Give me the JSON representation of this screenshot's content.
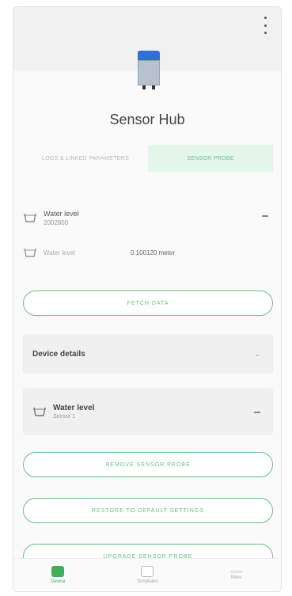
{
  "header": {
    "menu_icon": "kebab-menu-icon",
    "device_icon": "sensor-hub-device-icon",
    "title": "Sensor Hub"
  },
  "tabs": [
    {
      "label": "Logs & Linked Parameters",
      "active": false
    },
    {
      "label": "Sensor Probe",
      "active": true
    }
  ],
  "sensor_item": {
    "icon": "water-cup-icon",
    "name": "Water level",
    "id": "2002800",
    "reading_label": "Water level",
    "reading_value": "0.100120 meter"
  },
  "buttons": {
    "fetch_data": "Fetch data",
    "remove_probe": "Remove sensor probe",
    "restore_defaults": "Restore to default settings",
    "upgrade_probe": "Upgrade sensor probe"
  },
  "device_details": {
    "label": "Device details",
    "chevron_icon": "chevron-down-icon"
  },
  "sensor_card": {
    "name": "Water level",
    "sub": "Sensor 1"
  },
  "bottom_nav": [
    {
      "label": "Device",
      "icon": "device-nav-icon",
      "active": true
    },
    {
      "label": "Templates",
      "icon": "template-nav-icon",
      "active": false
    },
    {
      "label": "More",
      "icon": "more-nav-icon",
      "active": false
    }
  ],
  "colors": {
    "accent": "#66c085",
    "active_nav": "#3fae5b",
    "device_cap": "#2f6fd6"
  }
}
